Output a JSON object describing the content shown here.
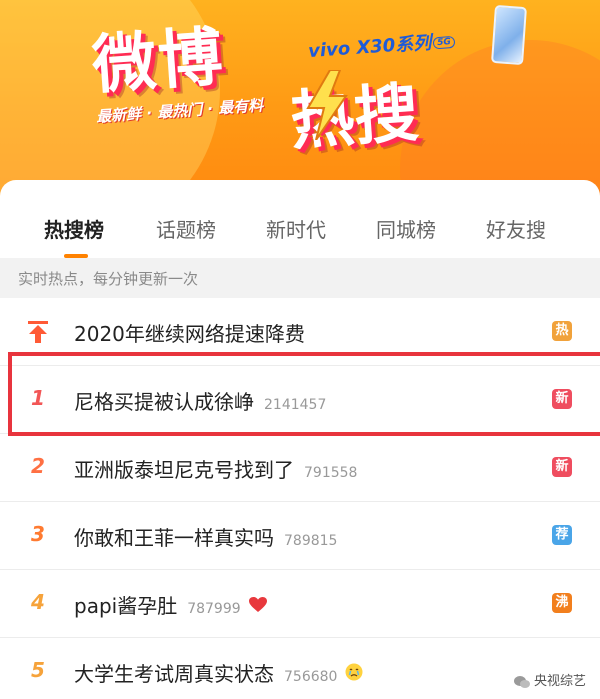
{
  "banner": {
    "title_part1": "微博",
    "title_part2": "热搜",
    "slogan": "最新鲜 · 最热门 · 最有料",
    "promo": "vivo X30系列",
    "promo_badge": "5G"
  },
  "tabs": [
    {
      "label": "热搜榜",
      "active": true
    },
    {
      "label": "话题榜",
      "active": false
    },
    {
      "label": "新时代",
      "active": false
    },
    {
      "label": "同城榜",
      "active": false
    },
    {
      "label": "好友搜",
      "active": false
    }
  ],
  "subhead": "实时热点，每分钟更新一次",
  "rows": [
    {
      "rank": "",
      "title": "2020年继续网络提速降费",
      "count": "",
      "emoji": "",
      "badge": "热",
      "badge_color": "#f1a23b",
      "rank_color": "#ff5a36"
    },
    {
      "rank": "1",
      "title": "尼格买提被认成徐峥",
      "count": "2141457",
      "emoji": "",
      "badge": "新",
      "badge_color": "#ef4d5f",
      "rank_color": "#f25656"
    },
    {
      "rank": "2",
      "title": "亚洲版泰坦尼克号找到了",
      "count": "791558",
      "emoji": "",
      "badge": "新",
      "badge_color": "#ef4d5f",
      "rank_color": "#ff7043"
    },
    {
      "rank": "3",
      "title": "你敢和王菲一样真实吗",
      "count": "789815",
      "emoji": "",
      "badge": "荐",
      "badge_color": "#4aa5e8",
      "rank_color": "#ff7a30"
    },
    {
      "rank": "4",
      "title": "papi酱孕肚",
      "count": "787999",
      "emoji": "heart-icon",
      "badge": "沸",
      "badge_color": "#f27f1d",
      "rank_color": "#f6a33b"
    },
    {
      "rank": "5",
      "title": "大学生考试周真实状态",
      "count": "756680",
      "emoji": "crying-face-icon",
      "badge": "",
      "badge_color": "",
      "rank_color": "#f6a33b"
    }
  ],
  "watermark": "央视综艺"
}
